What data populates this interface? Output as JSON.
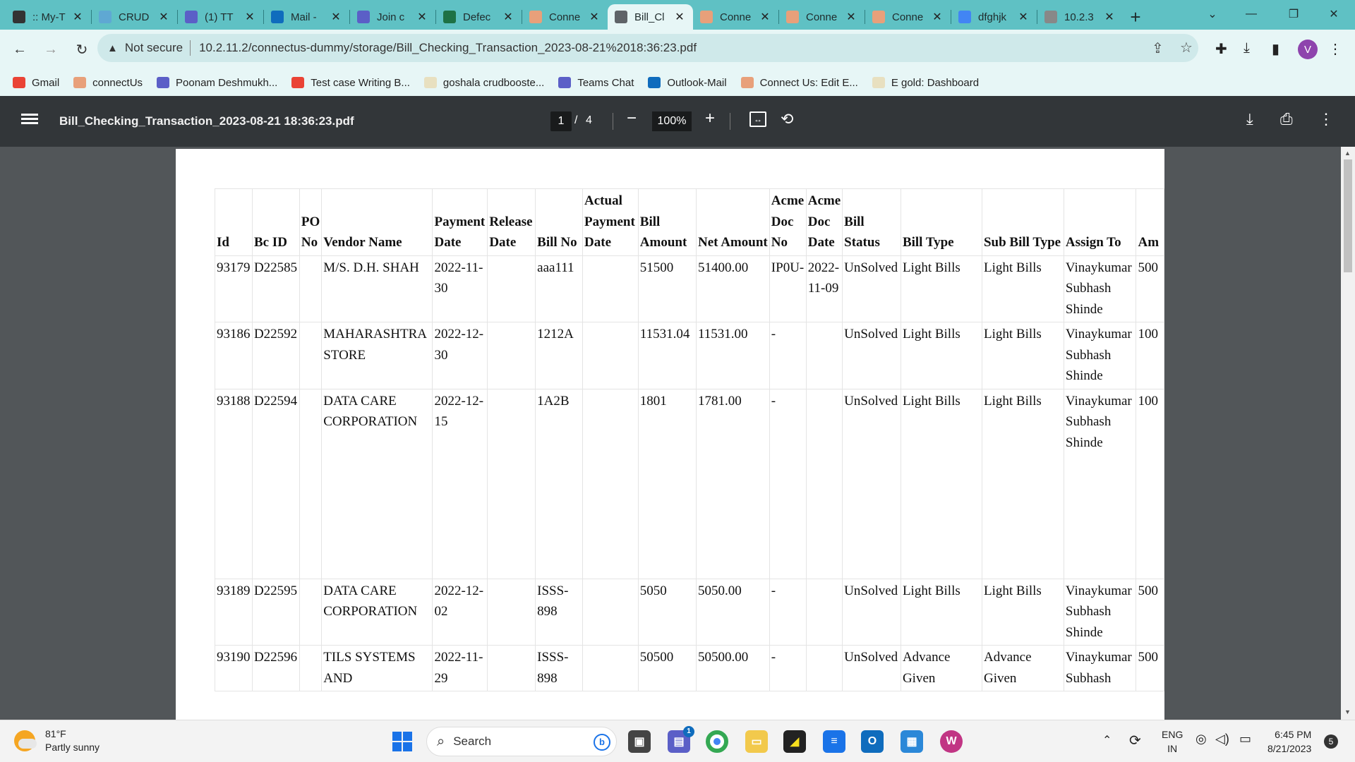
{
  "browser": {
    "tabs": [
      {
        "title": ":: My-T",
        "color": "#333"
      },
      {
        "title": "CRUD",
        "color": "#5fa8d3"
      },
      {
        "title": "(1) TT",
        "color": "#5b5fc7"
      },
      {
        "title": "Mail -",
        "color": "#0f6cbd"
      },
      {
        "title": "Join c",
        "color": "#5b5fc7"
      },
      {
        "title": "Defec",
        "color": "#1e7145"
      },
      {
        "title": "Conne",
        "color": "#e8a07a"
      },
      {
        "title": "Bill_Cl",
        "color": "#5f6368"
      },
      {
        "title": "Conne",
        "color": "#e8a07a"
      },
      {
        "title": "Conne",
        "color": "#e8a07a"
      },
      {
        "title": "Conne",
        "color": "#e8a07a"
      },
      {
        "title": "dfghjk",
        "color": "#4285f4"
      },
      {
        "title": "10.2.3",
        "color": "#888"
      }
    ],
    "active_tab": 7,
    "security_label": "Not secure",
    "url": "10.2.11.2/connectus-dummy/storage/Bill_Checking_Transaction_2023-08-21%2018:36:23.pdf",
    "profile_initial": "V",
    "bookmarks": [
      {
        "label": "Gmail",
        "color": "#ea4335"
      },
      {
        "label": "connectUs",
        "color": "#e8a07a"
      },
      {
        "label": "Poonam Deshmukh...",
        "color": "#5b5fc7"
      },
      {
        "label": "Test case Writing B...",
        "color": "#ea4335"
      },
      {
        "label": "goshala crudbooste...",
        "color": "#e8e0c0"
      },
      {
        "label": "Teams Chat",
        "color": "#5b5fc7"
      },
      {
        "label": "Outlook-Mail",
        "color": "#0f6cbd"
      },
      {
        "label": "Connect Us: Edit E...",
        "color": "#e8a07a"
      },
      {
        "label": "E gold: Dashboard",
        "color": "#e8e0c0"
      }
    ]
  },
  "pdf": {
    "title": "Bill_Checking_Transaction_2023-08-21 18:36:23.pdf",
    "page_current": "1",
    "page_sep": "/",
    "page_total": "4",
    "zoom": "100%"
  },
  "table": {
    "headers": [
      "Id",
      "Bc ID",
      "PO No",
      "Vendor Name",
      "Payment Date",
      "Release Date",
      "Bill No",
      "Actual Payment Date",
      "Bill Amount",
      "Net Amount",
      "Acme Doc No",
      "Acme Doc Date",
      "Bill Status",
      "Bill Type",
      "Sub Bill Type",
      "Assign To",
      "Am"
    ],
    "rows": [
      [
        "93179",
        "D22585",
        "",
        "M/S. D.H. SHAH",
        "2022-11-30",
        "",
        "aaa111",
        "",
        "51500",
        "51400.00",
        "IP0U-",
        "2022-11-09",
        "UnSolved",
        "Light Bills",
        "Light Bills",
        "Vinaykumar Subhash Shinde",
        "500"
      ],
      [
        "93186",
        "D22592",
        "",
        "MAHARASHTRA STORE",
        "2022-12-30",
        "",
        "1212A",
        "",
        "11531.04",
        "11531.00",
        "-",
        "",
        "UnSolved",
        "Light Bills",
        "Light Bills",
        "Vinaykumar Subhash Shinde",
        "100"
      ],
      [
        "93188",
        "D22594",
        "",
        "DATA CARE CORPORATION",
        "2022-12-15",
        "",
        "1A2B",
        "",
        "1801",
        "1781.00",
        "-",
        "",
        "UnSolved",
        "Light Bills",
        "Light Bills",
        "Vinaykumar Subhash Shinde",
        "100"
      ],
      [
        "93189",
        "D22595",
        "",
        "DATA CARE CORPORATION",
        "2022-12-02",
        "",
        "ISSS-898",
        "",
        "5050",
        "5050.00",
        "-",
        "",
        "UnSolved",
        "Light Bills",
        "Light Bills",
        "Vinaykumar Subhash Shinde",
        "500"
      ],
      [
        "93190",
        "D22596",
        "",
        "TILS SYSTEMS AND",
        "2022-11-29",
        "",
        "ISSS-898",
        "",
        "50500",
        "50500.00",
        "-",
        "",
        "UnSolved",
        "Advance Given",
        "Advance Given",
        "Vinaykumar Subhash",
        "500"
      ]
    ]
  },
  "taskbar": {
    "temperature": "81°F",
    "weather": "Partly sunny",
    "search_label": "Search",
    "lang1": "ENG",
    "lang2": "IN",
    "time": "6:45 PM",
    "date": "8/21/2023",
    "notifications": "5",
    "teams_badge": "1"
  }
}
